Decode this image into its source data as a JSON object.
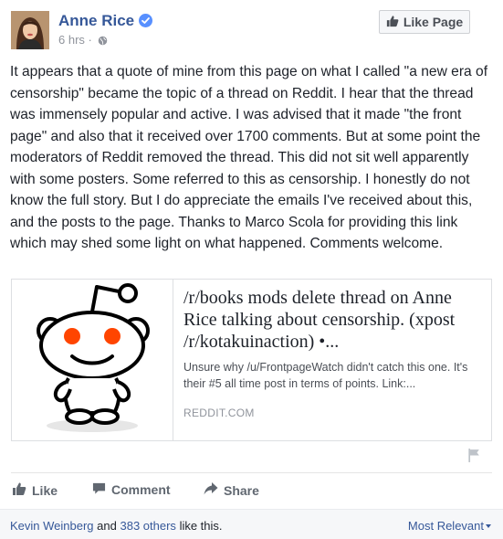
{
  "post": {
    "author": "Anne Rice",
    "timestamp": "6 hrs",
    "separator": "·",
    "like_page_label": "Like Page",
    "text": "It appears that a quote of mine from this page on what I called \"a new era of censorship\" became the topic of a thread on Reddit. I hear that the thread was immensely popular and active. I was advised that it made \"the front page\" and also that it received over 1700 comments. But at some point the moderators of Reddit removed the thread. This did not sit well apparently with some posters. Some referred to this as censorship. I honestly do not know the full story. But I do appreciate the emails I've received about this, and the posts to the page. Thanks to Marco Scola for providing this link which may shed some light on what happened. Comments welcome."
  },
  "link_card": {
    "title": "/r/books mods delete thread on Anne Rice talking about censorship. (xpost /r/kotakuinaction) •...",
    "description": "Unsure why /u/FrontpageWatch didn't catch this one. It's their #5 all time post in terms of points. Link:...",
    "domain": "REDDIT.COM"
  },
  "actions": {
    "like": "Like",
    "comment": "Comment",
    "share": "Share"
  },
  "likes": {
    "first_name": "Kevin Weinberg",
    "and": "and",
    "others_count": "383 others",
    "suffix": "like this.",
    "sort_label": "Most Relevant"
  },
  "icons": {
    "verified": "verified-badge-icon",
    "globe": "globe-icon",
    "thumbs_up": "thumbs-up-icon",
    "comment": "comment-bubble-icon",
    "share": "share-arrow-icon",
    "flag": "flag-icon",
    "reddit_alien": "reddit-alien-icon"
  },
  "colors": {
    "link_blue": "#365899",
    "verified_blue": "#5890ff",
    "reddit_orange": "#ff4500",
    "action_gray": "#606770"
  }
}
